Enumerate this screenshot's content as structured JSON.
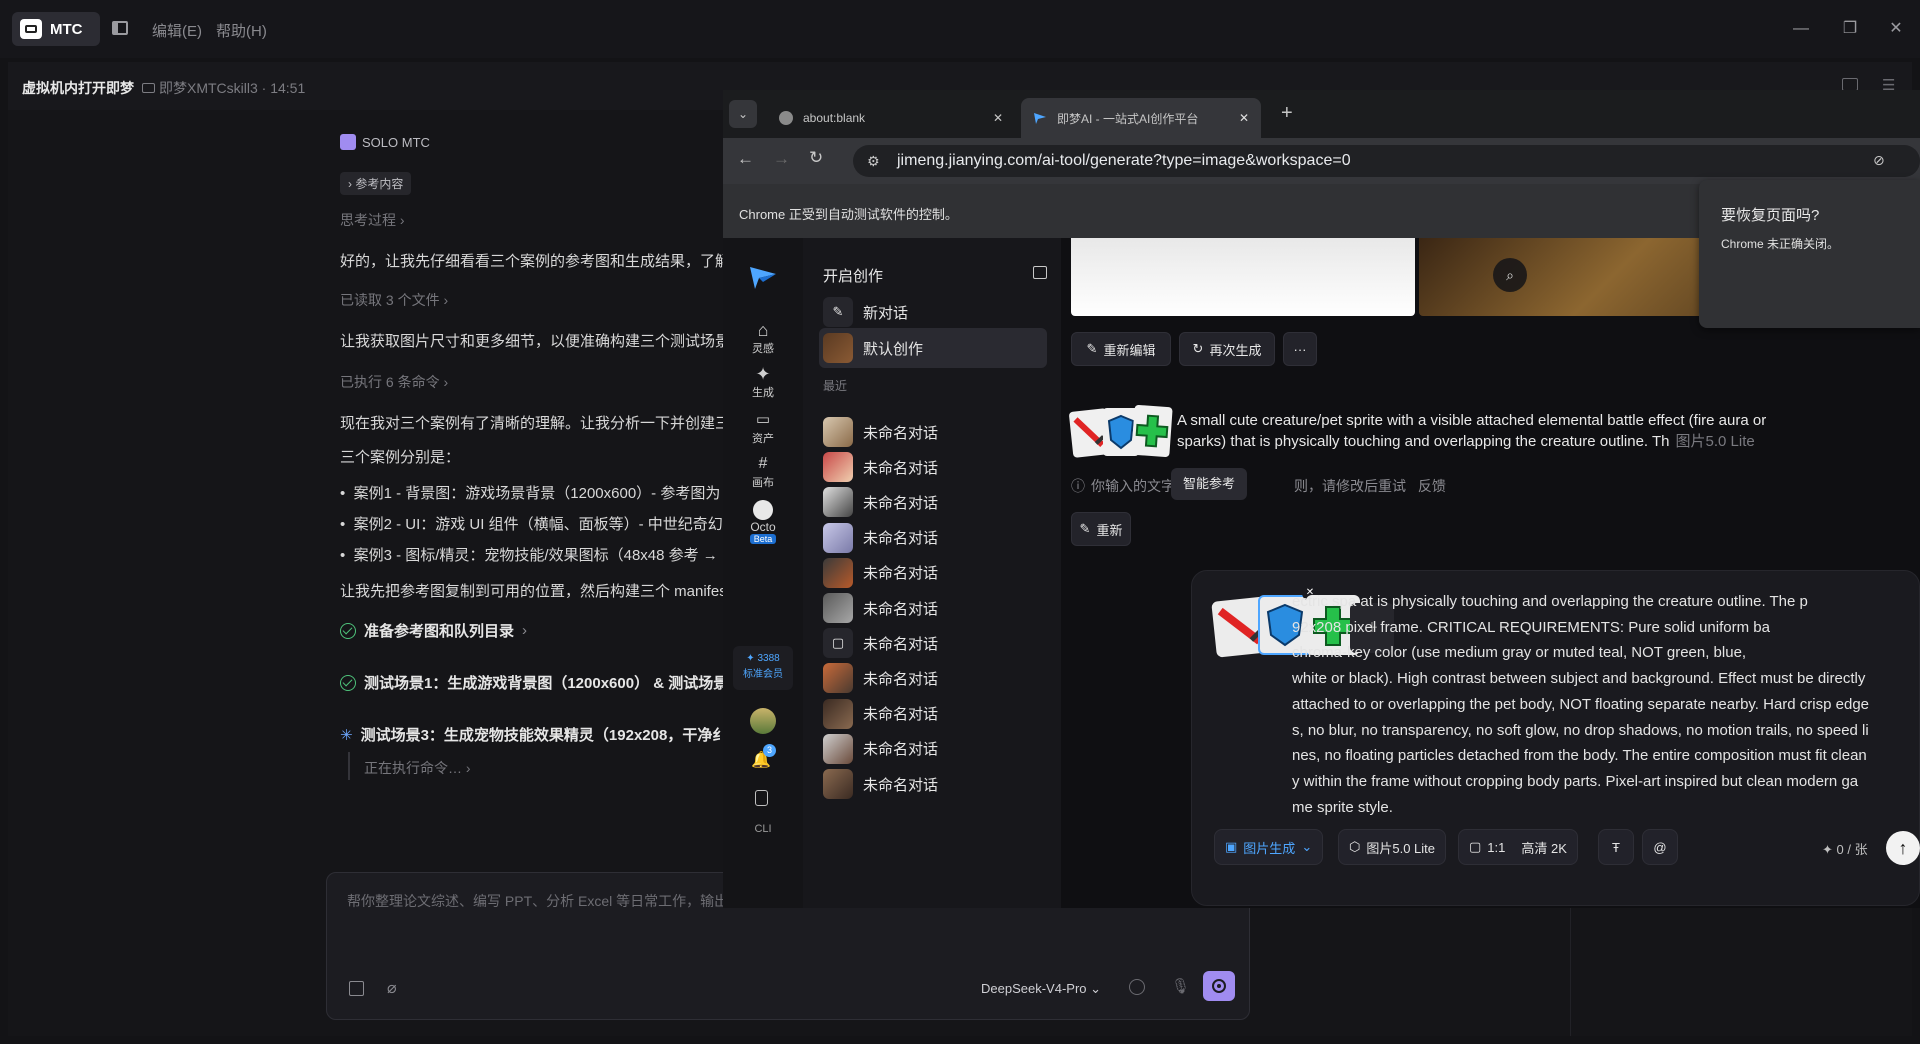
{
  "app": {
    "badge": "MTC",
    "menu": [
      "编辑(E)",
      "帮助(H)"
    ],
    "session_title": "虚拟机内打开即梦",
    "session_meta": "即梦XMTCskill3 · 14:51"
  },
  "chat": {
    "agent_name": "SOLO MTC",
    "reference_tag": "参考内容",
    "thinking": "思考过程",
    "intro": "好的，让我先仔细看看三个案例的参考图和生成结果，了解",
    "read_files": "已读取 3 个文件",
    "line2": "让我获取图片尺寸和更多细节，以便准确构建三个测试场景",
    "executed": "已执行 6 条命令",
    "line3": "现在我对三个案例有了清晰的理解。让我分析一下并创建三",
    "cases_title": "三个案例分别是：",
    "cases": [
      "案例1 - 背景图：游戏场景背景（1200x600）- 参考图为",
      "案例2 - UI：游戏 UI 组件（横幅、面板等）- 中世纪奇幻",
      "案例3 - 图标/精灵：宠物技能/效果图标（48x48 参考 →"
    ],
    "line4": "让我先把参考图复制到可用的位置，然后构建三个 manifes",
    "task1": "准备参考图和队列目录",
    "task2": "测试场景1：生成游戏背景图（1200x600） & 测试场景",
    "task3": "测试场景3：生成宠物技能效果精灵（192x208，干净纟",
    "running": "正在执行命令…"
  },
  "input": {
    "placeholder": "帮你整理论文综述、编写 PPT、分析 Excel 等日常工作，输出",
    "model": "DeepSeek-V4-Pro"
  },
  "browser": {
    "tabs": [
      {
        "title": "about:blank"
      },
      {
        "title": "即梦AI - 一站式AI创作平台"
      }
    ],
    "url": "jimeng.jianying.com/ai-tool/generate?type=image&workspace=0",
    "automation_notice": "Chrome 正受到自动测试软件的控制。",
    "restore_title": "要恢复页面吗?",
    "restore_body": "Chrome 未正确关闭。"
  },
  "jimeng": {
    "nav": [
      {
        "label": "灵感",
        "icon": "home-icon"
      },
      {
        "label": "生成",
        "icon": "sparkle-icon"
      },
      {
        "label": "资产",
        "icon": "folder-icon"
      },
      {
        "label": "画布",
        "icon": "canvas-icon"
      },
      {
        "label": "Octo",
        "icon": "octo-icon"
      }
    ],
    "octo_badge": "Beta",
    "points": "3388",
    "member": "标准会员",
    "notif_count": "3",
    "cli": "CLI",
    "panel_title": "开启创作",
    "new_chat": "新对话",
    "default_creation": "默认创作",
    "recent": "最近",
    "conversations": [
      "未命名对话",
      "未命名对话",
      "未命名对话",
      "未命名对话",
      "未命名对话",
      "未命名对话",
      "未命名对话",
      "未命名对话",
      "未命名对话",
      "未命名对话",
      "未命名对话"
    ],
    "reedit": "重新编辑",
    "regenerate": "再次生成",
    "more": "···",
    "prompt_line1": "A small cute creature/pet sprite with a visible attached elemental battle effect (fire aura or",
    "prompt_line2": "sparks) that is physically touching and overlapping the creature outline. Th",
    "prompt_model": "图片5.0 Lite",
    "error_text": "你输入的文字不",
    "error_text2": "则，请修改后重试",
    "feedback": "反馈",
    "smart_ref_tooltip": "智能参考",
    "reedit_short": "重新",
    "composer_text": "ectric spa[...] at is physically touching and overlapping the creature outline. The p 192x208 pixel frame. CRITICAL REQUIREMENTS: Pure solid uniform ba chroma-key color (use medium gray or muted teal, NOT green, blue, white or black). High contrast between subject and background. Effect must be directly attached to or overlapping the pet body, NOT floating separate nearby. Hard crisp edge s, no blur, no transparency, no soft glow, no drop shadows, no motion trails, no speed li nes, no floating particles detached from the body. The entire composition must fit clean y within the frame without cropping body parts. Pixel-art inspired but clean modern ga me sprite style.",
    "composer_lines": [
      "ectric spa    at is physically touching and overlapping the creature outline. The p",
      "   92x208 pixel frame. CRITICAL REQUIREMENTS: Pure solid uniform ba",
      "   chroma-key color (use medium gray or muted teal, NOT green, blue,",
      "white or black). High contrast between subject and background. Effect must be directly",
      "attached to or overlapping the pet body, NOT floating separate nearby. Hard crisp edge",
      "s, no blur, no transparency, no soft glow, no drop shadows, no motion trails, no speed li",
      "nes, no floating particles detached from the body. The entire composition must fit clean",
      "y within the frame without cropping body parts. Pixel-art inspired but clean modern ga",
      "me sprite style."
    ],
    "mode": "图片生成",
    "model": "图片5.0 Lite",
    "ratio": "1:1",
    "quality": "高清 2K",
    "cost": "0 / 张"
  },
  "colors": {
    "accent_purple": "#a08cf0",
    "jimeng_blue": "#4ea6ff",
    "success": "#4ec27a"
  }
}
